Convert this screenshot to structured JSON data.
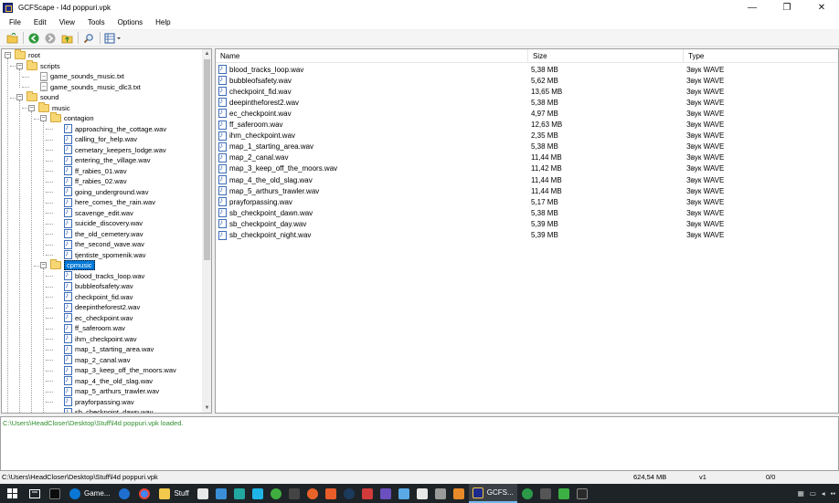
{
  "window": {
    "title": "GCFScape - l4d poppuri.vpk",
    "controls": [
      "—",
      "❐",
      "✕"
    ]
  },
  "menu": [
    "File",
    "Edit",
    "View",
    "Tools",
    "Options",
    "Help"
  ],
  "toolbar": {
    "icons": [
      "open-folder-icon",
      "back-icon",
      "forward-icon",
      "up-folder-icon",
      "find-icon",
      "view-mode-icon"
    ]
  },
  "tree": {
    "root": "root",
    "scripts": "scripts",
    "scripts_files": [
      "game_sounds_music.txt",
      "game_sounds_music_dlc3.txt"
    ],
    "sound": "sound",
    "music": "music",
    "contagion": "contagion",
    "contagion_files": [
      "approaching_the_cottage.wav",
      "calling_for_help.wav",
      "cemetary_keepers_lodge.wav",
      "entering_the_village.wav",
      "ff_rabies_01.wav",
      "ff_rabies_02.wav",
      "going_underground.wav",
      "here_comes_the_rain.wav",
      "scavenge_edit.wav",
      "suicide_discovery.wav",
      "the_old_cemetery.wav",
      "the_second_wave.wav",
      "tjentiste_spomenik.wav"
    ],
    "cpmusic": "cpmusic",
    "cpmusic_files": [
      "blood_tracks_loop.wav",
      "bubbleofsafety.wav",
      "checkpoint_fid.wav",
      "deepintheforest2.wav",
      "ec_checkpoint.wav",
      "ff_saferoom.wav",
      "ihm_checkpoint.wav",
      "map_1_starting_area.wav",
      "map_2_canal.wav",
      "map_3_keep_off_the_moors.wav",
      "map_4_the_old_slag.wav",
      "map_5_arthurs_trawler.wav",
      "prayforpassing.wav",
      "sb_checkpoint_dawn.wav"
    ]
  },
  "list": {
    "columns": [
      "Name",
      "Size",
      "Type"
    ],
    "rows": [
      [
        "blood_tracks_loop.wav",
        "5,38 MB",
        "Звук WAVE"
      ],
      [
        "bubbleofsafety.wav",
        "5,62 MB",
        "Звук WAVE"
      ],
      [
        "checkpoint_fid.wav",
        "13,65 MB",
        "Звук WAVE"
      ],
      [
        "deepintheforest2.wav",
        "5,38 MB",
        "Звук WAVE"
      ],
      [
        "ec_checkpoint.wav",
        "4,97 MB",
        "Звук WAVE"
      ],
      [
        "ff_saferoom.wav",
        "12,63 MB",
        "Звук WAVE"
      ],
      [
        "ihm_checkpoint.wav",
        "2,35 MB",
        "Звук WAVE"
      ],
      [
        "map_1_starting_area.wav",
        "5,38 MB",
        "Звук WAVE"
      ],
      [
        "map_2_canal.wav",
        "11,44 MB",
        "Звук WAVE"
      ],
      [
        "map_3_keep_off_the_moors.wav",
        "11,42 MB",
        "Звук WAVE"
      ],
      [
        "map_4_the_old_slag.wav",
        "11,44 MB",
        "Звук WAVE"
      ],
      [
        "map_5_arthurs_trawler.wav",
        "11,44 MB",
        "Звук WAVE"
      ],
      [
        "prayforpassing.wav",
        "5,17 MB",
        "Звук WAVE"
      ],
      [
        "sb_checkpoint_dawn.wav",
        "5,38 MB",
        "Звук WAVE"
      ],
      [
        "sb_checkpoint_day.wav",
        "5,39 MB",
        "Звук WAVE"
      ],
      [
        "sb_checkpoint_night.wav",
        "5,39 MB",
        "Звук WAVE"
      ]
    ]
  },
  "log": {
    "message": "C:\\Users\\HeadCloser\\Desktop\\Stuff\\l4d poppuri.vpk loaded."
  },
  "status": {
    "path": "C:\\Users\\HeadCloser\\Desktop\\Stuff\\l4d poppuri.vpk",
    "size": "624,54 MB",
    "version": "v1",
    "ratio": "0/0"
  },
  "taskbar": {
    "items": [
      {
        "label": "Game...",
        "icon": "edge-icon"
      },
      {
        "label": "Stuff",
        "icon": "file-explorer-icon"
      },
      {
        "label": "GCFS...",
        "icon": "gcfscape-icon"
      }
    ],
    "colors": {
      "bg": "#1e2327",
      "accent": "#76b9ed"
    }
  },
  "colors": {
    "selection": "#0078d7",
    "log_text": "#2f8f2f"
  }
}
